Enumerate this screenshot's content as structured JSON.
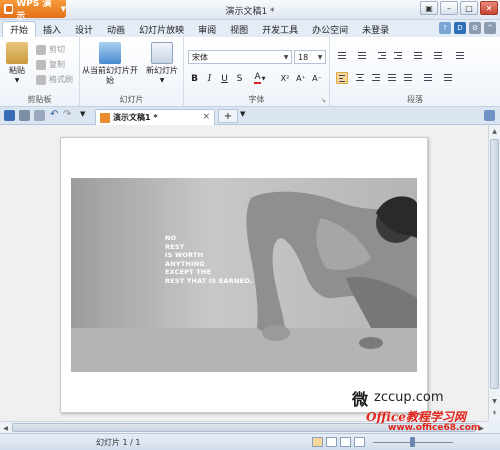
{
  "app": {
    "name": "WPS 演示",
    "window_title": "演示文稿1 *"
  },
  "menu": {
    "tabs": [
      "开始",
      "插入",
      "设计",
      "动画",
      "幻灯片放映",
      "审阅",
      "视图",
      "开发工具",
      "办公空间",
      "未登录"
    ],
    "active": "开始"
  },
  "ribbon": {
    "clipboard": {
      "label": "剪贴板",
      "paste": "粘贴",
      "cut": "剪切",
      "copy": "复制",
      "format_painter": "格式刷"
    },
    "slides": {
      "label": "幻灯片",
      "from_current": "从当前幻灯片开始",
      "new_slide": "新幻灯片"
    },
    "font": {
      "label": "字体",
      "font_name": "宋体",
      "font_size": "18",
      "bold": "B",
      "italic": "I",
      "underline": "U",
      "strike": "S",
      "superscript": "X²",
      "grow": "A⁺",
      "shrink": "A⁻"
    },
    "paragraph": {
      "label": "段落"
    }
  },
  "document": {
    "tab_title": "演示文稿1 *",
    "slide_quote": [
      "NO",
      "REST",
      "IS WORTH",
      "ANYTHING",
      "EXCEPT THE",
      "REST THAT IS EARNED."
    ]
  },
  "status": {
    "slide_indicator": "幻灯片 1 / 1"
  },
  "watermark": {
    "site1": "zccup.com",
    "site2": "Office教程学习网",
    "site3": "www.office68.com"
  }
}
